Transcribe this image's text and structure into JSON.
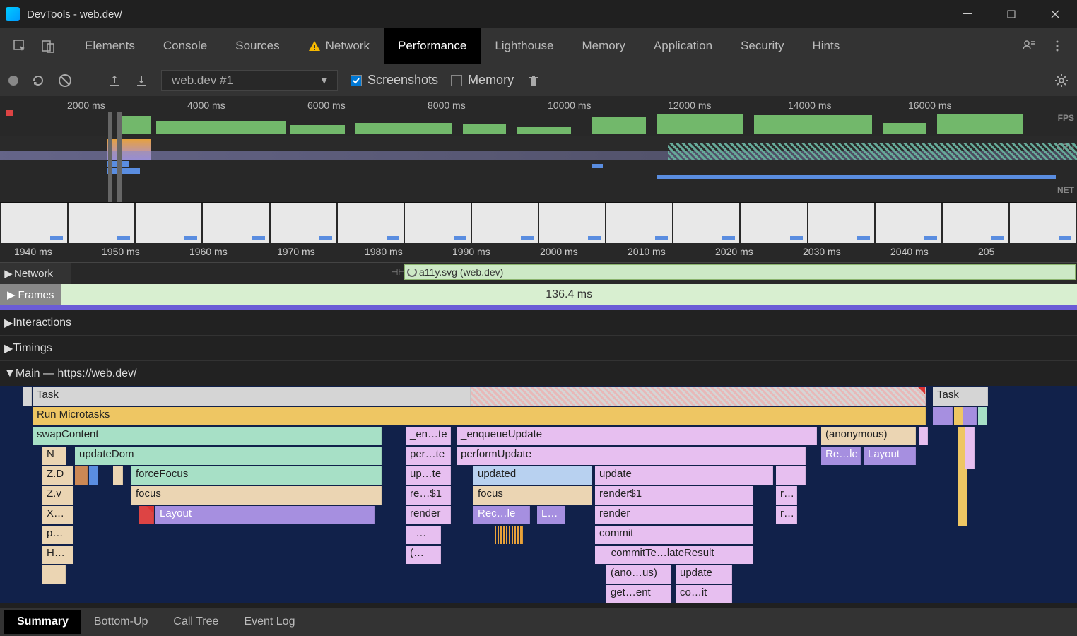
{
  "window": {
    "title": "DevTools - web.dev/"
  },
  "tabs": [
    "Elements",
    "Console",
    "Sources",
    "Network",
    "Performance",
    "Lighthouse",
    "Memory",
    "Application",
    "Security",
    "Hints"
  ],
  "active_tab": "Performance",
  "toolbar": {
    "trace": "web.dev #1",
    "screenshots_label": "Screenshots",
    "screenshots_checked": true,
    "memory_label": "Memory",
    "memory_checked": false
  },
  "overview": {
    "ticks": [
      "2000 ms",
      "4000 ms",
      "6000 ms",
      "8000 ms",
      "10000 ms",
      "12000 ms",
      "14000 ms",
      "16000 ms"
    ],
    "lanes": {
      "fps": "FPS",
      "cpu": "CPU",
      "net": "NET"
    }
  },
  "ruler": [
    "1940 ms",
    "1950 ms",
    "1960 ms",
    "1970 ms",
    "1980 ms",
    "1990 ms",
    "2000 ms",
    "2010 ms",
    "2020 ms",
    "2030 ms",
    "2040 ms",
    "205"
  ],
  "tracks": {
    "network": {
      "label": "Network",
      "item": "a11y.svg (web.dev)"
    },
    "frames": {
      "label": "Frames",
      "duration": "136.4 ms"
    },
    "interactions": "Interactions",
    "timings": "Timings",
    "main": "Main — https://web.dev/"
  },
  "flame": {
    "r0": {
      "task": "Task",
      "task2": "Task"
    },
    "r1": {
      "micro": "Run Microtasks"
    },
    "r2": {
      "swap": "swapContent",
      "en": "_en…te",
      "enq": "_enqueueUpdate",
      "anon": "(anonymous)"
    },
    "r3": {
      "n": "N",
      "updom": "updateDom",
      "per": "per…te",
      "perf": "performUpdate",
      "rele": "Re…le",
      "layout": "Layout"
    },
    "r4": {
      "zd": "Z.D",
      "ff": "forceFocus",
      "up": "up…te",
      "upd": "updated",
      "update": "update"
    },
    "r5": {
      "zv": "Z.v",
      "focus": "focus",
      "re": "re…$1",
      "focus2": "focus",
      "render1": "render$1",
      "r": "r…"
    },
    "r6": {
      "x": "X…",
      "layout": "Layout",
      "render": "render",
      "rec": "Rec…le",
      "l": "L…",
      "render2": "render",
      "r": "r…"
    },
    "r7": {
      "p": "p…",
      "u": "_…",
      "commit": "commit"
    },
    "r8": {
      "h": "H…",
      "paren": "(…",
      "ctr": "__commitTe…lateResult"
    },
    "r9": {
      "anous": "(ano…us)",
      "update": "update"
    },
    "r10": {
      "get": "get…ent",
      "coit": "co…it"
    }
  },
  "bottom_tabs": [
    "Summary",
    "Bottom-Up",
    "Call Tree",
    "Event Log"
  ],
  "bottom_active": "Summary"
}
